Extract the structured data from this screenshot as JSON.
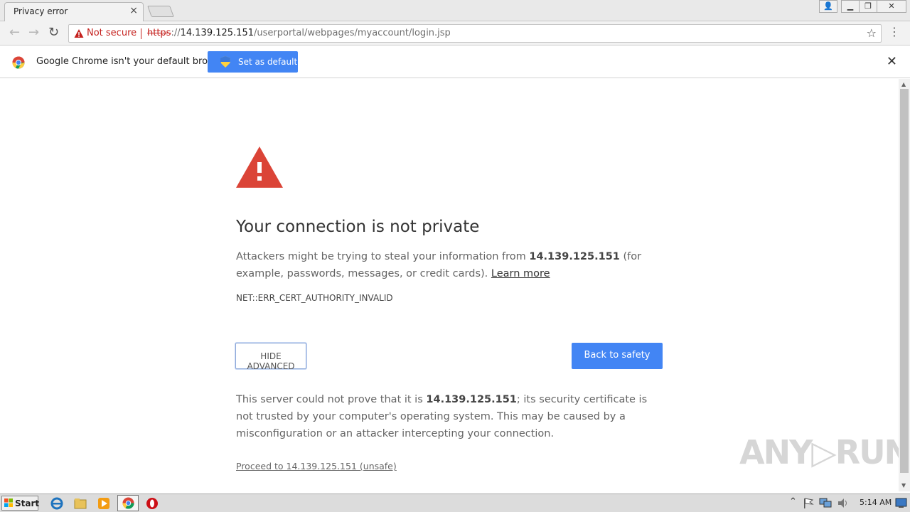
{
  "tab": {
    "title": "Privacy error",
    "close_glyph": "×"
  },
  "window_controls": {
    "user": "👤",
    "minimize": "▁",
    "restore": "❐",
    "close": "✕"
  },
  "toolbar": {
    "back_glyph": "←",
    "forward_glyph": "→",
    "reload_glyph": "↻",
    "not_secure_label": "Not secure",
    "url_scheme": "https",
    "url_sep": "://",
    "url_host": "14.139.125.151",
    "url_path": "/userportal/webpages/myaccount/login.jsp",
    "star_glyph": "☆",
    "menu_glyph": "⋮"
  },
  "infobar": {
    "message": "Google Chrome isn't your default browser",
    "button_label": "Set as default",
    "close_glyph": "✕"
  },
  "interstitial": {
    "heading": "Your connection is not private",
    "para1_before": "Attackers might be trying to steal your information from ",
    "para1_host": "14.139.125.151",
    "para1_after": " (for example, passwords, messages, or credit cards). ",
    "learn_more": "Learn more",
    "error_code": "NET::ERR_CERT_AUTHORITY_INVALID",
    "hide_advanced": "HIDE ADVANCED",
    "back_to_safety": "Back to safety",
    "para2_before": "This server could not prove that it is ",
    "para2_host": "14.139.125.151",
    "para2_after": "; its security certificate is not trusted by your computer's operating system. This may be caused by a misconfiguration or an attacker intercepting your connection.",
    "proceed_link": "Proceed to 14.139.125.151 (unsafe)"
  },
  "watermark": "ANY▷RUN",
  "taskbar": {
    "start_label": "Start",
    "clock": "5:14 AM",
    "tray_up_glyph": "⌃"
  },
  "colors": {
    "accent_blue": "#4285f4",
    "danger_red": "#db4437",
    "not_secure_red": "#c5221f"
  }
}
